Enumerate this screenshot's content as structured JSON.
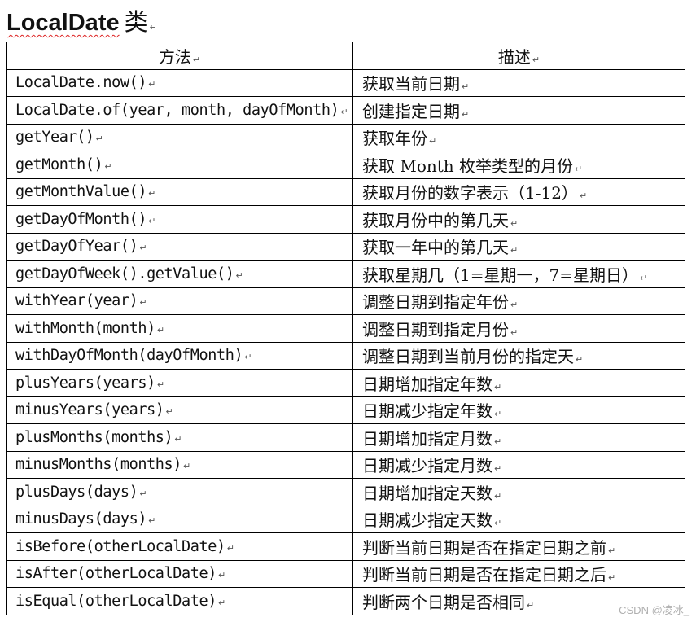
{
  "title": {
    "main": "LocalDate",
    "cn": "类"
  },
  "headers": {
    "method": "方法",
    "description": "描述"
  },
  "rows": [
    {
      "method": "LocalDate.now()",
      "description": "获取当前日期"
    },
    {
      "method": "LocalDate.of(year, month, dayOfMonth)",
      "description": "创建指定日期"
    },
    {
      "method": "getYear()",
      "description": "获取年份"
    },
    {
      "method": "getMonth()",
      "description": "获取 Month 枚举类型的月份"
    },
    {
      "method": "getMonthValue()",
      "description": "获取月份的数字表示（1-12）"
    },
    {
      "method": "getDayOfMonth()",
      "description": "获取月份中的第几天"
    },
    {
      "method": "getDayOfYear()",
      "description": "获取一年中的第几天"
    },
    {
      "method": "getDayOfWeek().getValue()",
      "description": "获取星期几（1=星期一，7=星期日）"
    },
    {
      "method": "withYear(year)",
      "description": "调整日期到指定年份"
    },
    {
      "method": "withMonth(month)",
      "description": "调整日期到指定月份"
    },
    {
      "method": "withDayOfMonth(dayOfMonth)",
      "description": "调整日期到当前月份的指定天"
    },
    {
      "method": "plusYears(years)",
      "description": "日期增加指定年数"
    },
    {
      "method": "minusYears(years)",
      "description": "日期减少指定年数"
    },
    {
      "method": "plusMonths(months)",
      "description": "日期增加指定月数"
    },
    {
      "method": "minusMonths(months)",
      "description": "日期减少指定月数"
    },
    {
      "method": "plusDays(days)",
      "description": "日期增加指定天数"
    },
    {
      "method": "minusDays(days)",
      "description": "日期减少指定天数"
    },
    {
      "method": "isBefore(otherLocalDate)",
      "description": "判断当前日期是否在指定日期之前"
    },
    {
      "method": "isAfter(otherLocalDate)",
      "description": "判断当前日期是否在指定日期之后"
    },
    {
      "method": "isEqual(otherLocalDate)",
      "description": "判断两个日期是否相同"
    }
  ],
  "watermark": "CSDN @凌冰_",
  "paragraph_mark": "↵"
}
